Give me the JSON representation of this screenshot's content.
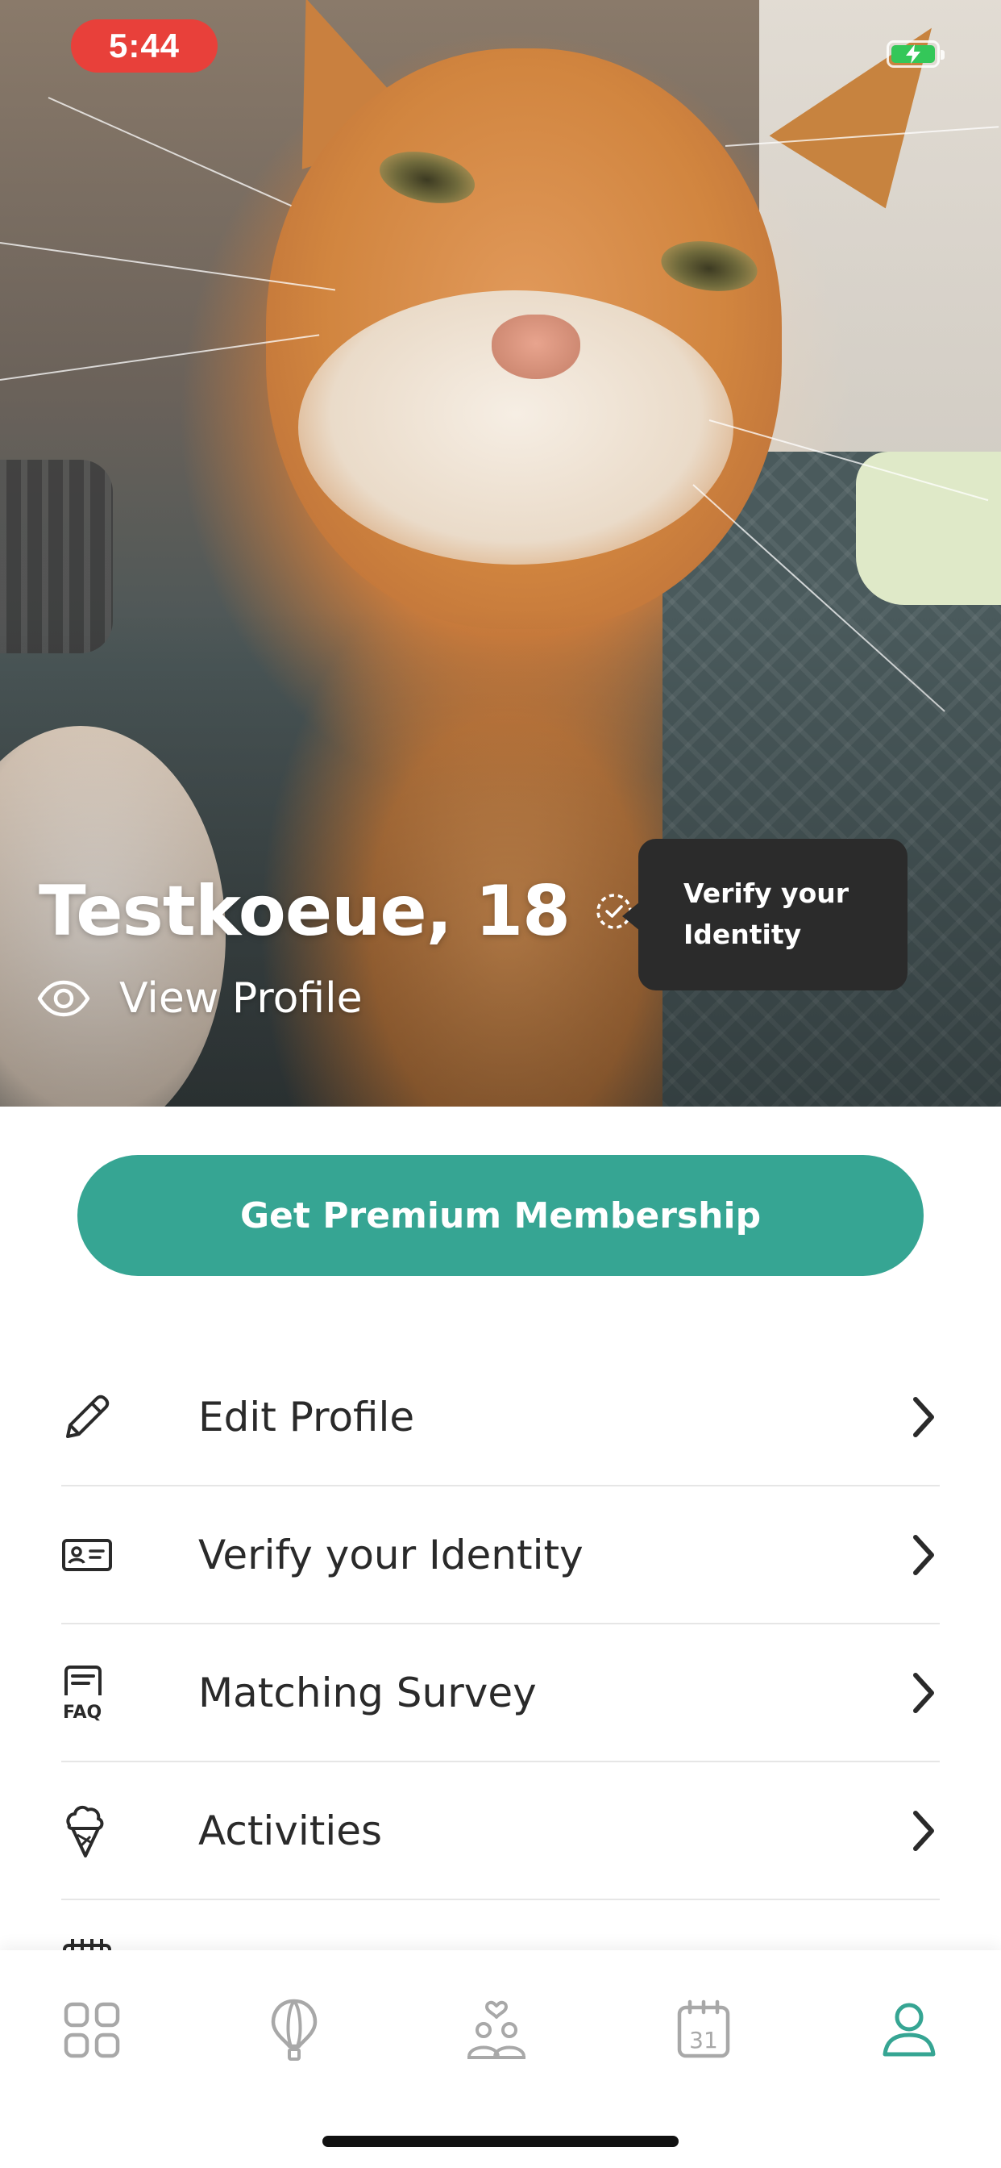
{
  "status_bar": {
    "time": "5:44",
    "time_pill_color": "#e8403a",
    "battery": "charging"
  },
  "profile": {
    "name_age": "Testkoeue, 18",
    "verified_icon": "dashed-check-circle-icon",
    "view_profile_label": "View Profile",
    "photo": "orange tabby cat selfie"
  },
  "tooltip": {
    "line1": "Verify your",
    "line2": "Identity"
  },
  "premium": {
    "label": "Get Premium Membership",
    "color": "#36a593"
  },
  "menu": {
    "items": [
      {
        "label": "Edit Profile",
        "icon": "pencil-icon"
      },
      {
        "label": "Verify your Identity",
        "icon": "id-card-icon"
      },
      {
        "label": "Matching Survey",
        "icon": "faq-icon"
      },
      {
        "label": "Activities",
        "icon": "ice-cream-icon"
      }
    ]
  },
  "tabbar": {
    "tabs": [
      {
        "name": "discover",
        "icon": "grid-icon",
        "active": false
      },
      {
        "name": "activities",
        "icon": "hot-air-balloon-icon",
        "active": false
      },
      {
        "name": "matches",
        "icon": "people-heart-icon",
        "active": false
      },
      {
        "name": "calendar",
        "icon": "calendar-icon",
        "label": "31",
        "active": false
      },
      {
        "name": "profile",
        "icon": "user-icon",
        "active": true
      }
    ],
    "active_color": "#36a593",
    "inactive_color": "#a8a8a8"
  }
}
